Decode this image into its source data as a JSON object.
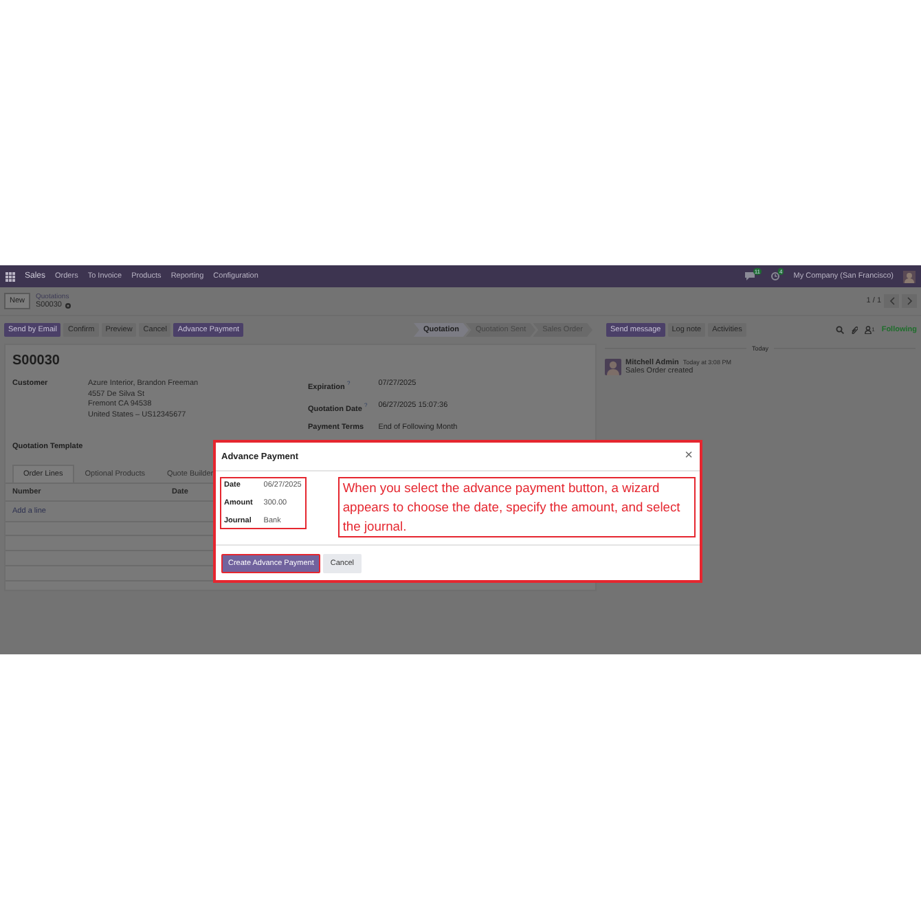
{
  "navbar": {
    "app": "Sales",
    "menu": [
      "Orders",
      "To Invoice",
      "Products",
      "Reporting",
      "Configuration"
    ],
    "message_count": "11",
    "activity_count": "4",
    "company": "My Company (San Francisco)"
  },
  "control_panel": {
    "new_button": "New",
    "breadcrumb_parent": "Quotations",
    "record": "S00030",
    "pager": "1 / 1"
  },
  "actions": [
    {
      "label": "Send by Email",
      "kind": "primary"
    },
    {
      "label": "Confirm",
      "kind": "secondary"
    },
    {
      "label": "Preview",
      "kind": "secondary"
    },
    {
      "label": "Cancel",
      "kind": "secondary"
    },
    {
      "label": "Advance Payment",
      "kind": "primary"
    }
  ],
  "stages": [
    {
      "label": "Quotation",
      "selected": true
    },
    {
      "label": "Quotation Sent",
      "selected": false
    },
    {
      "label": "Sales Order",
      "selected": false
    }
  ],
  "form": {
    "title": "S00030",
    "customer_label": "Customer",
    "customer": "Azure Interior, Brandon Freeman",
    "address": [
      "4557 De Silva St",
      "Fremont CA 94538",
      "United States – US12345677"
    ],
    "right_fields": [
      {
        "label": "Expiration",
        "help": "?",
        "value": "07/27/2025"
      },
      {
        "label": "Quotation Date",
        "help": "?",
        "value": "06/27/2025 15:07:36"
      },
      {
        "label": "Payment Terms",
        "value": "End of Following Month"
      }
    ],
    "template_label": "Quotation Template",
    "tabs": [
      {
        "label": "Order Lines",
        "selected": true
      },
      {
        "label": "Optional Products",
        "selected": false
      },
      {
        "label": "Quote Builder",
        "selected": false
      }
    ],
    "columns": [
      "Number",
      "Date"
    ],
    "add_line": "Add a line"
  },
  "chatter": {
    "buttons": [
      {
        "label": "Send message",
        "kind": "primary"
      },
      {
        "label": "Log note",
        "kind": "secondary"
      },
      {
        "label": "Activities",
        "kind": "secondary"
      }
    ],
    "follower_count": "1",
    "following": "Following",
    "day": "Today",
    "messages": [
      {
        "author": "Mitchell Admin",
        "time": "Today at 3:08 PM",
        "body": "Sales Order created"
      }
    ]
  },
  "dialog": {
    "title": "Advance Payment",
    "close": "×",
    "fields": [
      {
        "label": "Date",
        "value": "06/27/2025"
      },
      {
        "label": "Amount",
        "value": "300.00"
      },
      {
        "label": "Journal",
        "value": "Bank"
      }
    ],
    "annotation": "When you select the advance payment button, a wizard appears to choose the date, specify the amount, and select the journal.",
    "buttons": [
      {
        "label": "Create Advance Payment",
        "kind": "primary"
      },
      {
        "label": "Cancel",
        "kind": "secondary"
      }
    ]
  }
}
